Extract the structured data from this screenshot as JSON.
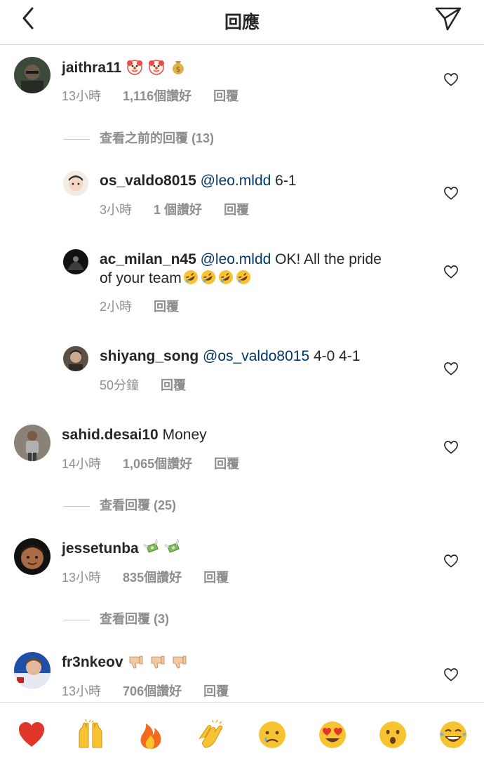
{
  "header": {
    "title": "回應"
  },
  "comments": [
    {
      "username": "jaithra11",
      "text": "",
      "time": "13小時",
      "likes": "1,116個讚好",
      "reply": "回覆",
      "view_more": "查看之前的回覆 (13)",
      "emoji": [
        "clown-face",
        "clown-face",
        "money-bag"
      ]
    },
    {
      "username": "os_valdo8015",
      "mention": "@leo.mldd",
      "text": "6-1",
      "time": "3小時",
      "likes": "1 個讚好",
      "reply": "回覆"
    },
    {
      "username": "ac_milan_n45",
      "mention": "@leo.mldd",
      "text": "OK! All the pride",
      "text2": "of your team",
      "time": "2小時",
      "reply": "回覆",
      "emoji": [
        "rofl-face",
        "rofl-face",
        "rofl-face",
        "rofl-face"
      ]
    },
    {
      "username": "shiyang_song",
      "mention": "@os_valdo8015",
      "text": "4-0 4-1",
      "time": "50分鐘",
      "reply": "回覆"
    },
    {
      "username": "sahid.desai10",
      "text": "Money",
      "time": "14小時",
      "likes": "1,065個讚好",
      "reply": "回覆",
      "view_more": "查看回覆 (25)"
    },
    {
      "username": "jessetunba",
      "text": "",
      "time": "13小時",
      "likes": "835個讚好",
      "reply": "回覆",
      "view_more": "查看回覆 (3)",
      "emoji": [
        "money-with-wings",
        "money-with-wings"
      ]
    },
    {
      "username": "fr3nkeov",
      "text": "",
      "time": "13小時",
      "likes": "706個讚好",
      "reply": "回覆",
      "emoji": [
        "thumbs-down",
        "thumbs-down",
        "thumbs-down"
      ]
    }
  ],
  "reactions": [
    "heart",
    "raised-hands",
    "fire",
    "clapping-hands",
    "crying-face",
    "heart-eyes",
    "surprised-face",
    "tears-of-joy"
  ],
  "colors": {
    "text": "#262626",
    "secondary": "#8e8e8e",
    "mention": "#00376b",
    "divider": "#dbdbdb"
  }
}
